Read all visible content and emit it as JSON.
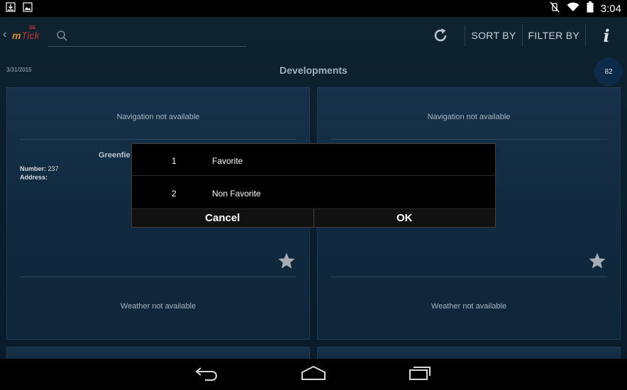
{
  "status_bar": {
    "time": "3:04",
    "icons": [
      "download-icon",
      "image-icon",
      "mute-icon",
      "wifi-icon",
      "battery-icon"
    ]
  },
  "app": {
    "logo_text": "mTick",
    "logo_superscript": "SE",
    "search": {
      "placeholder": ""
    },
    "actions": {
      "sort_label": "SORT BY",
      "filter_label": "FILTER BY",
      "info_label": "i"
    }
  },
  "subheader": {
    "date": "3/31/2015",
    "title": "Developments",
    "count": "82"
  },
  "cards": [
    {
      "navigation": "Navigation not available",
      "name": "Greenfie",
      "number_label": "Number:",
      "number_value": "237",
      "address_label": "Address:",
      "address_value": "",
      "weather": "Weather not available"
    },
    {
      "navigation": "Navigation not available",
      "weather": "Weather not available"
    }
  ],
  "dialog": {
    "options": [
      {
        "num": "1",
        "label": "Favorite"
      },
      {
        "num": "2",
        "label": "Non Favorite"
      }
    ],
    "cancel_label": "Cancel",
    "ok_label": "OK"
  },
  "colors": {
    "background": "#0b1e2c",
    "card": "#132d44",
    "badge": "#0d2a48",
    "dialog": "#000000"
  }
}
